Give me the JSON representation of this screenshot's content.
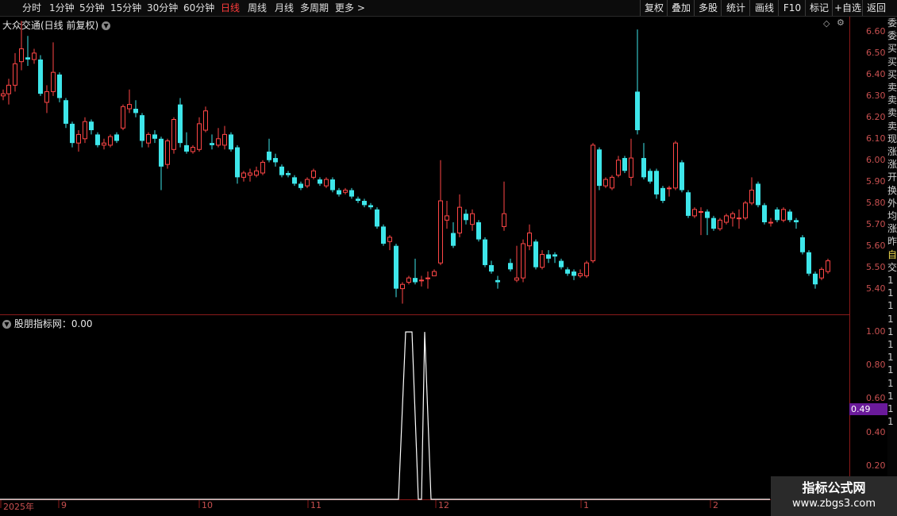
{
  "toolbar": {
    "left": [
      {
        "label": "分时",
        "x": 28
      },
      {
        "label": "1分钟",
        "x": 62
      },
      {
        "label": "5分钟",
        "x": 100
      },
      {
        "label": "15分钟",
        "x": 139
      },
      {
        "label": "30分钟",
        "x": 185
      },
      {
        "label": "60分钟",
        "x": 231
      },
      {
        "label": "日线",
        "x": 278,
        "active": true
      },
      {
        "label": "周线",
        "x": 312
      },
      {
        "label": "月线",
        "x": 346
      },
      {
        "label": "多周期",
        "x": 378
      },
      {
        "label": "更多 >",
        "x": 422
      }
    ],
    "right": [
      {
        "label": "复权",
        "x": 806,
        "w": 34
      },
      {
        "label": "叠加",
        "x": 840,
        "w": 34
      },
      {
        "label": "多股",
        "x": 874,
        "w": 34
      },
      {
        "label": "统计",
        "x": 908,
        "w": 36
      },
      {
        "label": "画线",
        "x": 944,
        "w": 36
      },
      {
        "label": "F10",
        "x": 980,
        "w": 34
      },
      {
        "label": "标记",
        "x": 1014,
        "w": 34
      },
      {
        "label": "+自选",
        "x": 1048,
        "w": 38
      },
      {
        "label": "返回",
        "x": 1086,
        "w": 34
      }
    ]
  },
  "main_title": "大众交通(日线 前复权)",
  "indicator_title": "股朋指标网：0.00",
  "price_axis": [
    "6.60",
    "6.50",
    "6.40",
    "6.30",
    "6.20",
    "6.10",
    "6.00",
    "5.90",
    "5.80",
    "5.70",
    "5.60",
    "5.50",
    "5.40"
  ],
  "ind_axis": [
    "1.00",
    "0.80",
    "0.60",
    "0.40",
    "0.20"
  ],
  "ind_tag": "0.49",
  "x_labels": [
    {
      "label": "2025年",
      "x": 4
    },
    {
      "label": "9",
      "x": 77
    },
    {
      "label": "10",
      "x": 254
    },
    {
      "label": "11",
      "x": 391
    },
    {
      "label": "12",
      "x": 552
    },
    {
      "label": "1",
      "x": 735
    },
    {
      "label": "2",
      "x": 898
    }
  ],
  "side_strip": [
    "委",
    "委",
    "买",
    "买",
    "买",
    "卖",
    "卖",
    "卖",
    "卖",
    "现",
    "涨",
    "涨",
    "开",
    "换",
    "外",
    "均",
    "涨",
    "昨",
    "自",
    "交",
    "1",
    "1",
    "1",
    "1",
    "1",
    "1",
    "1",
    "1",
    "1",
    "1",
    "1",
    "1"
  ],
  "watermark": {
    "line1": "指标公式网",
    "line2": "www.zbgs3.com"
  },
  "colors": {
    "up": "#ff4646",
    "down": "#3ee6ea",
    "axis": "#8b1a1a",
    "label": "#c85050"
  },
  "chart_data": {
    "type": "candlestick",
    "title": "大众交通(日线 前复权)",
    "ylim": [
      5.28,
      6.67
    ],
    "candles": [
      {
        "x": 4,
        "o": 6.3,
        "c": 6.31,
        "h": 6.33,
        "l": 6.28
      },
      {
        "x": 11,
        "o": 6.31,
        "c": 6.35,
        "h": 6.38,
        "l": 6.26
      },
      {
        "x": 19,
        "o": 6.35,
        "c": 6.45,
        "h": 6.5,
        "l": 6.32
      },
      {
        "x": 27,
        "o": 6.46,
        "c": 6.52,
        "h": 6.65,
        "l": 6.42
      },
      {
        "x": 35,
        "o": 6.48,
        "c": 6.47,
        "h": 6.58,
        "l": 6.44
      },
      {
        "x": 43,
        "o": 6.47,
        "c": 6.5,
        "h": 6.52,
        "l": 6.45
      },
      {
        "x": 51,
        "o": 6.47,
        "c": 6.31,
        "h": 6.49,
        "l": 6.3
      },
      {
        "x": 59,
        "o": 6.27,
        "c": 6.32,
        "h": 6.35,
        "l": 6.22
      },
      {
        "x": 67,
        "o": 6.32,
        "c": 6.41,
        "h": 6.55,
        "l": 6.3
      },
      {
        "x": 75,
        "o": 6.4,
        "c": 6.29,
        "h": 6.41,
        "l": 6.27
      },
      {
        "x": 83,
        "o": 6.28,
        "c": 6.17,
        "h": 6.29,
        "l": 6.15
      },
      {
        "x": 91,
        "o": 6.17,
        "c": 6.08,
        "h": 6.18,
        "l": 6.06
      },
      {
        "x": 99,
        "o": 6.08,
        "c": 6.12,
        "h": 6.14,
        "l": 6.04
      },
      {
        "x": 107,
        "o": 6.1,
        "c": 6.18,
        "h": 6.2,
        "l": 6.08
      },
      {
        "x": 115,
        "o": 6.18,
        "c": 6.14,
        "h": 6.19,
        "l": 6.12
      },
      {
        "x": 123,
        "o": 6.12,
        "c": 6.07,
        "h": 6.13,
        "l": 6.06
      },
      {
        "x": 131,
        "o": 6.07,
        "c": 6.08,
        "h": 6.1,
        "l": 6.05
      },
      {
        "x": 139,
        "o": 6.07,
        "c": 6.11,
        "h": 6.12,
        "l": 6.06
      },
      {
        "x": 147,
        "o": 6.12,
        "c": 6.09,
        "h": 6.13,
        "l": 6.08
      },
      {
        "x": 155,
        "o": 6.15,
        "c": 6.25,
        "h": 6.26,
        "l": 6.14
      },
      {
        "x": 163,
        "o": 6.24,
        "c": 6.26,
        "h": 6.33,
        "l": 6.22
      },
      {
        "x": 171,
        "o": 6.24,
        "c": 6.22,
        "h": 6.28,
        "l": 6.2
      },
      {
        "x": 179,
        "o": 6.21,
        "c": 6.09,
        "h": 6.22,
        "l": 6.06
      },
      {
        "x": 187,
        "o": 6.08,
        "c": 6.12,
        "h": 6.13,
        "l": 6.06
      },
      {
        "x": 195,
        "o": 6.12,
        "c": 6.1,
        "h": 6.14,
        "l": 6.08
      },
      {
        "x": 203,
        "o": 6.1,
        "c": 5.97,
        "h": 6.11,
        "l": 5.86
      },
      {
        "x": 211,
        "o": 5.98,
        "c": 6.09,
        "h": 6.1,
        "l": 5.96
      },
      {
        "x": 219,
        "o": 6.05,
        "c": 6.19,
        "h": 6.2,
        "l": 6.03
      },
      {
        "x": 227,
        "o": 6.26,
        "c": 6.08,
        "h": 6.29,
        "l": 6.06
      },
      {
        "x": 235,
        "o": 6.07,
        "c": 6.04,
        "h": 6.13,
        "l": 6.03
      },
      {
        "x": 243,
        "o": 6.04,
        "c": 6.06,
        "h": 6.07,
        "l": 6.03
      },
      {
        "x": 251,
        "o": 6.05,
        "c": 6.17,
        "h": 6.2,
        "l": 6.04
      },
      {
        "x": 259,
        "o": 6.14,
        "c": 6.23,
        "h": 6.25,
        "l": 6.13
      },
      {
        "x": 267,
        "o": 6.08,
        "c": 6.07,
        "h": 6.12,
        "l": 6.05
      },
      {
        "x": 275,
        "o": 6.07,
        "c": 6.1,
        "h": 6.15,
        "l": 6.06
      },
      {
        "x": 283,
        "o": 6.07,
        "c": 6.12,
        "h": 6.16,
        "l": 6.05
      },
      {
        "x": 291,
        "o": 6.12,
        "c": 6.05,
        "h": 6.13,
        "l": 6.04
      },
      {
        "x": 299,
        "o": 6.06,
        "c": 5.92,
        "h": 6.07,
        "l": 5.89
      },
      {
        "x": 307,
        "o": 5.92,
        "c": 5.94,
        "h": 5.95,
        "l": 5.9
      },
      {
        "x": 315,
        "o": 5.93,
        "c": 5.94,
        "h": 5.96,
        "l": 5.9
      },
      {
        "x": 323,
        "o": 5.93,
        "c": 5.95,
        "h": 5.97,
        "l": 5.92
      },
      {
        "x": 331,
        "o": 5.94,
        "c": 5.99,
        "h": 6.0,
        "l": 5.93
      },
      {
        "x": 339,
        "o": 6.04,
        "c": 6.0,
        "h": 6.1,
        "l": 5.99
      },
      {
        "x": 347,
        "o": 6.01,
        "c": 5.99,
        "h": 6.03,
        "l": 5.97
      },
      {
        "x": 355,
        "o": 5.97,
        "c": 5.93,
        "h": 5.98,
        "l": 5.92
      },
      {
        "x": 363,
        "o": 5.94,
        "c": 5.93,
        "h": 5.95,
        "l": 5.92
      },
      {
        "x": 371,
        "o": 5.92,
        "c": 5.89,
        "h": 5.93,
        "l": 5.88
      },
      {
        "x": 379,
        "o": 5.89,
        "c": 5.87,
        "h": 5.9,
        "l": 5.86
      },
      {
        "x": 387,
        "o": 5.88,
        "c": 5.91,
        "h": 5.92,
        "l": 5.87
      },
      {
        "x": 395,
        "o": 5.92,
        "c": 5.95,
        "h": 5.96,
        "l": 5.91
      },
      {
        "x": 403,
        "o": 5.91,
        "c": 5.89,
        "h": 5.92,
        "l": 5.88
      },
      {
        "x": 411,
        "o": 5.88,
        "c": 5.91,
        "h": 5.92,
        "l": 5.87
      },
      {
        "x": 419,
        "o": 5.91,
        "c": 5.86,
        "h": 5.92,
        "l": 5.85
      },
      {
        "x": 427,
        "o": 5.86,
        "c": 5.84,
        "h": 5.87,
        "l": 5.83
      },
      {
        "x": 435,
        "o": 5.85,
        "c": 5.86,
        "h": 5.87,
        "l": 5.84
      },
      {
        "x": 443,
        "o": 5.86,
        "c": 5.83,
        "h": 5.87,
        "l": 5.82
      },
      {
        "x": 451,
        "o": 5.82,
        "c": 5.81,
        "h": 5.83,
        "l": 5.8
      },
      {
        "x": 459,
        "o": 5.81,
        "c": 5.79,
        "h": 5.82,
        "l": 5.78
      },
      {
        "x": 467,
        "o": 5.79,
        "c": 5.78,
        "h": 5.8,
        "l": 5.77
      },
      {
        "x": 475,
        "o": 5.77,
        "c": 5.69,
        "h": 5.78,
        "l": 5.68
      },
      {
        "x": 483,
        "o": 5.69,
        "c": 5.61,
        "h": 5.7,
        "l": 5.6
      },
      {
        "x": 491,
        "o": 5.62,
        "c": 5.64,
        "h": 5.65,
        "l": 5.58
      },
      {
        "x": 499,
        "o": 5.6,
        "c": 5.4,
        "h": 5.61,
        "l": 5.36
      },
      {
        "x": 507,
        "o": 5.4,
        "c": 5.42,
        "h": 5.43,
        "l": 5.33
      },
      {
        "x": 515,
        "o": 5.43,
        "c": 5.45,
        "h": 5.46,
        "l": 5.42
      },
      {
        "x": 523,
        "o": 5.45,
        "c": 5.43,
        "h": 5.54,
        "l": 5.42
      },
      {
        "x": 531,
        "o": 5.44,
        "c": 5.44,
        "h": 5.46,
        "l": 5.41
      },
      {
        "x": 539,
        "o": 5.45,
        "c": 5.45,
        "h": 5.48,
        "l": 5.4
      },
      {
        "x": 547,
        "o": 5.46,
        "c": 5.48,
        "h": 5.49,
        "l": 5.46
      },
      {
        "x": 555,
        "o": 5.52,
        "c": 5.81,
        "h": 6.0,
        "l": 5.51
      },
      {
        "x": 563,
        "o": 5.72,
        "c": 5.74,
        "h": 5.81,
        "l": 5.68
      },
      {
        "x": 571,
        "o": 5.66,
        "c": 5.6,
        "h": 5.71,
        "l": 5.59
      },
      {
        "x": 579,
        "o": 5.66,
        "c": 5.78,
        "h": 5.84,
        "l": 5.64
      },
      {
        "x": 587,
        "o": 5.75,
        "c": 5.72,
        "h": 5.77,
        "l": 5.7
      },
      {
        "x": 595,
        "o": 5.7,
        "c": 5.75,
        "h": 5.77,
        "l": 5.67
      },
      {
        "x": 603,
        "o": 5.71,
        "c": 5.63,
        "h": 5.72,
        "l": 5.62
      },
      {
        "x": 611,
        "o": 5.63,
        "c": 5.51,
        "h": 5.64,
        "l": 5.5
      },
      {
        "x": 619,
        "o": 5.51,
        "c": 5.48,
        "h": 5.53,
        "l": 5.47
      },
      {
        "x": 627,
        "o": 5.44,
        "c": 5.43,
        "h": 5.46,
        "l": 5.4
      },
      {
        "x": 635,
        "o": 5.69,
        "c": 5.75,
        "h": 5.9,
        "l": 5.67
      },
      {
        "x": 643,
        "o": 5.52,
        "c": 5.49,
        "h": 5.54,
        "l": 5.48
      },
      {
        "x": 651,
        "o": 5.44,
        "c": 5.45,
        "h": 5.6,
        "l": 5.43
      },
      {
        "x": 659,
        "o": 5.45,
        "c": 5.61,
        "h": 5.63,
        "l": 5.43
      },
      {
        "x": 667,
        "o": 5.6,
        "c": 5.66,
        "h": 5.7,
        "l": 5.58
      },
      {
        "x": 675,
        "o": 5.62,
        "c": 5.5,
        "h": 5.63,
        "l": 5.49
      },
      {
        "x": 683,
        "o": 5.5,
        "c": 5.56,
        "h": 5.58,
        "l": 5.49
      },
      {
        "x": 691,
        "o": 5.56,
        "c": 5.54,
        "h": 5.58,
        "l": 5.52
      },
      {
        "x": 699,
        "o": 5.56,
        "c": 5.55,
        "h": 5.57,
        "l": 5.52
      },
      {
        "x": 707,
        "o": 5.53,
        "c": 5.5,
        "h": 5.54,
        "l": 5.49
      },
      {
        "x": 715,
        "o": 5.49,
        "c": 5.47,
        "h": 5.5,
        "l": 5.46
      },
      {
        "x": 723,
        "o": 5.48,
        "c": 5.46,
        "h": 5.49,
        "l": 5.44
      },
      {
        "x": 731,
        "o": 5.46,
        "c": 5.47,
        "h": 5.49,
        "l": 5.45
      },
      {
        "x": 739,
        "o": 5.46,
        "c": 5.52,
        "h": 5.53,
        "l": 5.45
      },
      {
        "x": 747,
        "o": 5.53,
        "c": 6.07,
        "h": 6.08,
        "l": 5.52
      },
      {
        "x": 755,
        "o": 6.05,
        "c": 5.88,
        "h": 6.06,
        "l": 5.86
      },
      {
        "x": 763,
        "o": 5.88,
        "c": 5.91,
        "h": 5.92,
        "l": 5.87
      },
      {
        "x": 771,
        "o": 5.87,
        "c": 5.92,
        "h": 5.93,
        "l": 5.86
      },
      {
        "x": 779,
        "o": 5.93,
        "c": 6.0,
        "h": 6.02,
        "l": 5.92
      },
      {
        "x": 787,
        "o": 6.01,
        "c": 5.95,
        "h": 6.02,
        "l": 5.94
      },
      {
        "x": 795,
        "o": 5.92,
        "c": 6.01,
        "h": 6.1,
        "l": 5.88
      },
      {
        "x": 803,
        "o": 6.32,
        "c": 6.14,
        "h": 6.61,
        "l": 6.12
      },
      {
        "x": 811,
        "o": 6.01,
        "c": 5.92,
        "h": 6.08,
        "l": 5.91
      },
      {
        "x": 819,
        "o": 5.95,
        "c": 5.9,
        "h": 5.96,
        "l": 5.89
      },
      {
        "x": 827,
        "o": 5.95,
        "c": 5.84,
        "h": 5.96,
        "l": 5.82
      },
      {
        "x": 835,
        "o": 5.87,
        "c": 5.81,
        "h": 5.88,
        "l": 5.8
      },
      {
        "x": 843,
        "o": 5.87,
        "c": 5.87,
        "h": 5.88,
        "l": 5.83
      },
      {
        "x": 851,
        "o": 5.87,
        "c": 6.08,
        "h": 6.09,
        "l": 5.86
      },
      {
        "x": 859,
        "o": 5.99,
        "c": 5.86,
        "h": 6.0,
        "l": 5.85
      },
      {
        "x": 867,
        "o": 5.85,
        "c": 5.74,
        "h": 5.86,
        "l": 5.73
      },
      {
        "x": 875,
        "o": 5.74,
        "c": 5.77,
        "h": 5.78,
        "l": 5.73
      },
      {
        "x": 883,
        "o": 5.76,
        "c": 5.76,
        "h": 5.78,
        "l": 5.65
      },
      {
        "x": 891,
        "o": 5.76,
        "c": 5.73,
        "h": 5.77,
        "l": 5.65
      },
      {
        "x": 899,
        "o": 5.73,
        "c": 5.68,
        "h": 5.74,
        "l": 5.67
      },
      {
        "x": 907,
        "o": 5.68,
        "c": 5.72,
        "h": 5.73,
        "l": 5.67
      },
      {
        "x": 915,
        "o": 5.71,
        "c": 5.74,
        "h": 5.75,
        "l": 5.7
      },
      {
        "x": 923,
        "o": 5.73,
        "c": 5.75,
        "h": 5.76,
        "l": 5.69
      },
      {
        "x": 931,
        "o": 5.73,
        "c": 5.73,
        "h": 5.77,
        "l": 5.68
      },
      {
        "x": 939,
        "o": 5.73,
        "c": 5.8,
        "h": 5.81,
        "l": 5.72
      },
      {
        "x": 947,
        "o": 5.8,
        "c": 5.86,
        "h": 5.92,
        "l": 5.79
      },
      {
        "x": 955,
        "o": 5.89,
        "c": 5.79,
        "h": 5.9,
        "l": 5.78
      },
      {
        "x": 963,
        "o": 5.79,
        "c": 5.71,
        "h": 5.8,
        "l": 5.7
      },
      {
        "x": 971,
        "o": 5.71,
        "c": 5.71,
        "h": 5.73,
        "l": 5.69
      },
      {
        "x": 979,
        "o": 5.77,
        "c": 5.72,
        "h": 5.78,
        "l": 5.71
      },
      {
        "x": 987,
        "o": 5.72,
        "c": 5.77,
        "h": 5.78,
        "l": 5.71
      },
      {
        "x": 995,
        "o": 5.76,
        "c": 5.72,
        "h": 5.77,
        "l": 5.71
      },
      {
        "x": 1003,
        "o": 5.72,
        "c": 5.71,
        "h": 5.73,
        "l": 5.68
      },
      {
        "x": 1011,
        "o": 5.64,
        "c": 5.57,
        "h": 5.65,
        "l": 5.56
      },
      {
        "x": 1019,
        "o": 5.57,
        "c": 5.47,
        "h": 5.58,
        "l": 5.46
      },
      {
        "x": 1027,
        "o": 5.47,
        "c": 5.42,
        "h": 5.48,
        "l": 5.4
      },
      {
        "x": 1035,
        "o": 5.45,
        "c": 5.49,
        "h": 5.5,
        "l": 5.44
      },
      {
        "x": 1043,
        "o": 5.48,
        "c": 5.53,
        "h": 5.54,
        "l": 5.47
      }
    ],
    "indicator": {
      "name": "股朋指标网",
      "ylim": [
        0,
        1.1
      ],
      "points": [
        [
          0,
          0
        ],
        [
          502,
          0
        ],
        [
          511,
          1
        ],
        [
          519,
          1
        ],
        [
          527,
          0
        ],
        [
          531,
          0
        ],
        [
          535,
          1
        ],
        [
          543,
          0
        ],
        [
          970,
          0
        ]
      ]
    }
  }
}
